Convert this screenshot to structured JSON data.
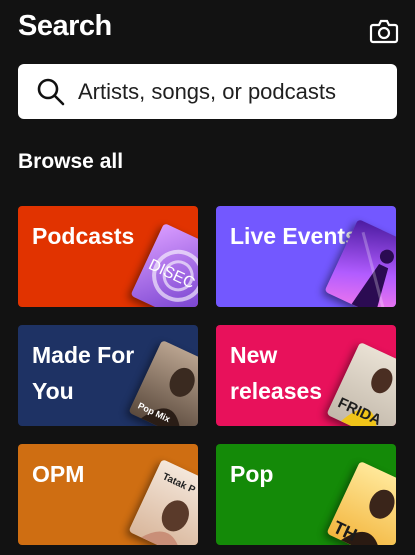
{
  "header": {
    "title": "Search",
    "camera_icon": "camera-icon"
  },
  "search": {
    "placeholder": "Artists, songs, or podcasts",
    "icon": "search-icon"
  },
  "browse": {
    "title": "Browse all"
  },
  "cards": [
    {
      "label": "Podcasts",
      "color": "#e13300",
      "art_text": "DISEC"
    },
    {
      "label": "Live Events",
      "color": "#7358ff",
      "art_text": ""
    },
    {
      "label": "Made For You",
      "color": "#1e3264",
      "art_text": "Pop Mix"
    },
    {
      "label": "New releases",
      "color": "#e8115b",
      "art_text": "FRIDA"
    },
    {
      "label": "OPM",
      "color": "#cf6e12",
      "art_text": "Tatak P"
    },
    {
      "label": "Pop",
      "color": "#148a08",
      "art_text": "TH"
    }
  ]
}
